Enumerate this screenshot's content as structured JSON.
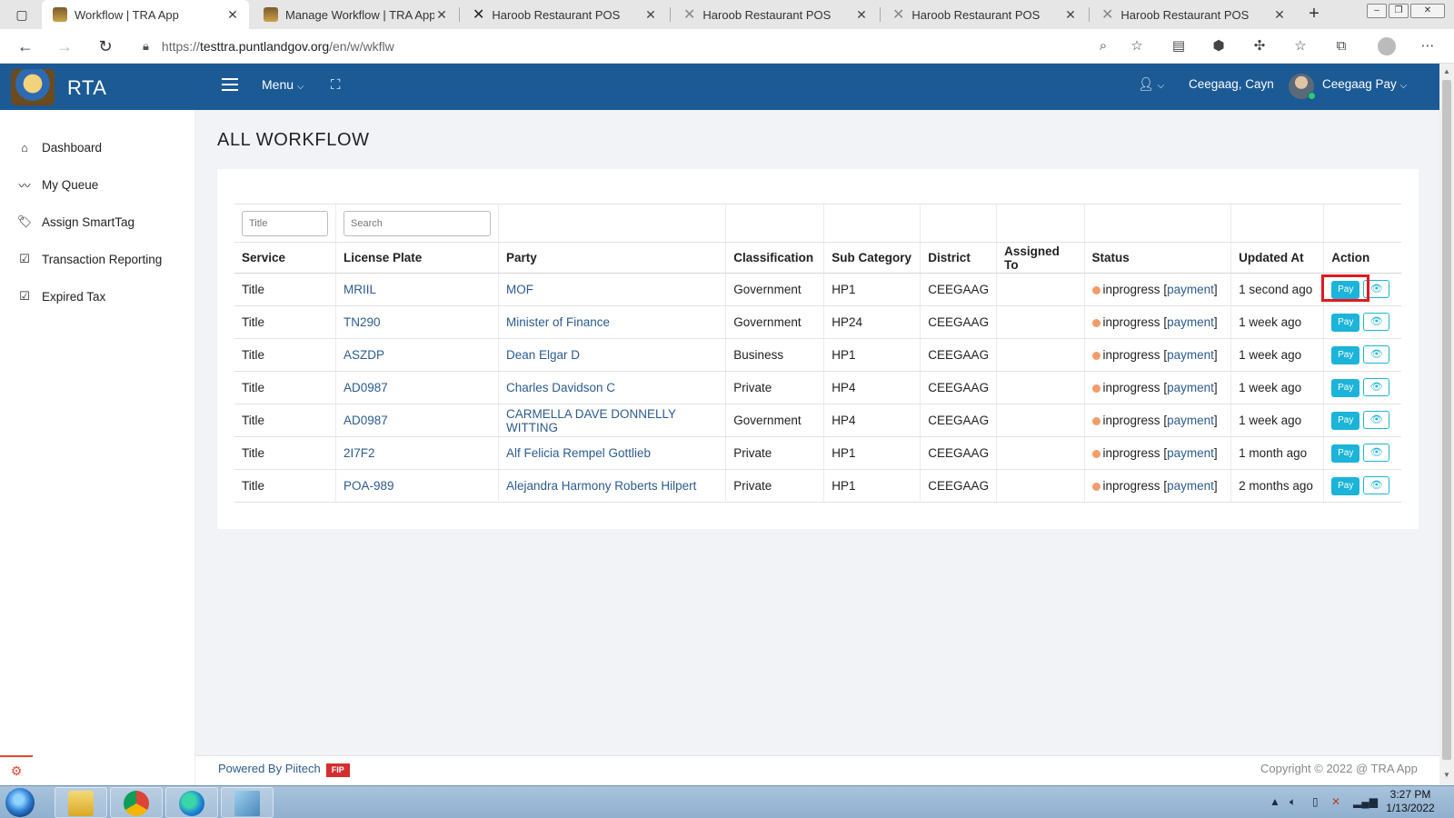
{
  "browser": {
    "tabs": [
      {
        "title": "Workflow | TRA App",
        "icon": "crest-icon",
        "active": true
      },
      {
        "title": "Manage Workflow | TRA App",
        "icon": "crest-icon",
        "active": false
      },
      {
        "title": "Haroob Restaurant POS",
        "icon": "x-logo-icon",
        "active": false
      },
      {
        "title": "Haroob Restaurant POS",
        "icon": "x-logo-icon",
        "active": false
      },
      {
        "title": "Haroob Restaurant POS",
        "icon": "x-logo-icon",
        "active": false
      },
      {
        "title": "Haroob Restaurant POS",
        "icon": "x-logo-icon",
        "active": false
      }
    ],
    "url_prefix": "https://",
    "url_host": "testtra.puntlandgov.org",
    "url_path": "/en/w/wkflw"
  },
  "header": {
    "brand": "RTA",
    "menu_label": "Menu",
    "user_short": "Ceegaag, Cayn",
    "user_name": "Ceegaag Pay",
    "color": "#1b5a95"
  },
  "sidebar": {
    "items": [
      {
        "label": "Dashboard",
        "icon": "home-icon"
      },
      {
        "label": "My Queue",
        "icon": "trend-icon"
      },
      {
        "label": "Assign SmartTag",
        "icon": "tags-icon"
      },
      {
        "label": "Transaction Reporting",
        "icon": "check-square-icon"
      },
      {
        "label": "Expired Tax",
        "icon": "check-square-icon"
      }
    ]
  },
  "page": {
    "title": "ALL WORKFLOW",
    "filter_title_placeholder": "Title",
    "filter_search_placeholder": "Search"
  },
  "table": {
    "columns": [
      "Service",
      "License Plate",
      "Party",
      "Classification",
      "Sub Category",
      "District",
      "Assigned To",
      "Status",
      "Updated At",
      "Action"
    ],
    "rows": [
      {
        "service": "Title",
        "plate": "MRIIL",
        "party": "MOF",
        "classification": "Government",
        "sub_category": "HP1",
        "district": "CEEGAAG",
        "assigned_to": "",
        "status": "inprogress",
        "status_link": "payment",
        "updated": "1 second ago"
      },
      {
        "service": "Title",
        "plate": "TN290",
        "party": "Minister of Finance",
        "classification": "Government",
        "sub_category": "HP24",
        "district": "CEEGAAG",
        "assigned_to": "",
        "status": "inprogress",
        "status_link": "payment",
        "updated": "1 week ago"
      },
      {
        "service": "Title",
        "plate": "ASZDP",
        "party": "Dean Elgar D",
        "classification": "Business",
        "sub_category": "HP1",
        "district": "CEEGAAG",
        "assigned_to": "",
        "status": "inprogress",
        "status_link": "payment",
        "updated": "1 week ago"
      },
      {
        "service": "Title",
        "plate": "AD0987",
        "party": "Charles Davidson C",
        "classification": "Private",
        "sub_category": "HP4",
        "district": "CEEGAAG",
        "assigned_to": "",
        "status": "inprogress",
        "status_link": "payment",
        "updated": "1 week ago"
      },
      {
        "service": "Title",
        "plate": "AD0987",
        "party": "CARMELLA DAVE DONNELLY WITTING",
        "classification": "Government",
        "sub_category": "HP4",
        "district": "CEEGAAG",
        "assigned_to": "",
        "status": "inprogress",
        "status_link": "payment",
        "updated": "1 week ago"
      },
      {
        "service": "Title",
        "plate": "2I7F2",
        "party": "Alf Felicia Rempel Gottlieb",
        "classification": "Private",
        "sub_category": "HP1",
        "district": "CEEGAAG",
        "assigned_to": "",
        "status": "inprogress",
        "status_link": "payment",
        "updated": "1 month ago"
      },
      {
        "service": "Title",
        "plate": "POA-989",
        "party": "Alejandra Harmony Roberts Hilpert",
        "classification": "Private",
        "sub_category": "HP1",
        "district": "CEEGAAG",
        "assigned_to": "",
        "status": "inprogress",
        "status_link": "payment",
        "updated": "2 months ago"
      }
    ],
    "pay_label": "Pay",
    "status_dot_color": "#f39c6b",
    "button_color": "#1cb4d8"
  },
  "footer": {
    "powered_by": "Powered By Piitech",
    "badge": "FIP",
    "copyright": "Copyright © 2022 @ TRA App"
  },
  "taskbar": {
    "time": "3:27 PM",
    "date": "1/13/2022"
  }
}
